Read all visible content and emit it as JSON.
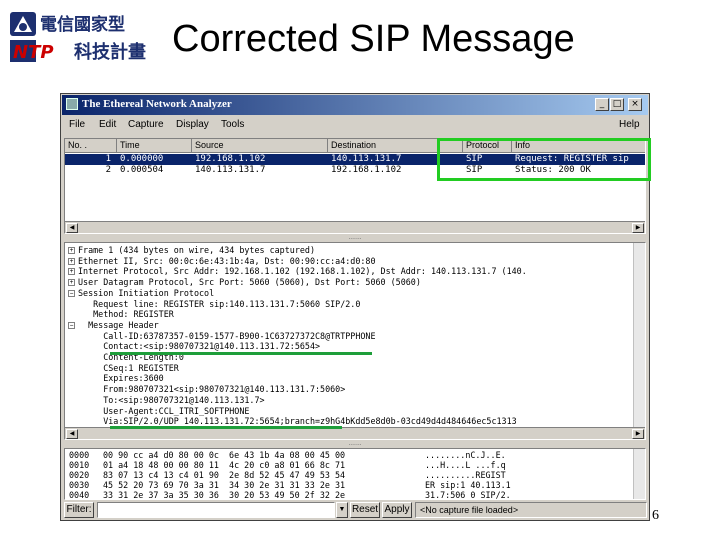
{
  "slide": {
    "title": "Corrected SIP Message",
    "page_number": "6",
    "logo_text_en": "NTP",
    "logo_text_zh_top": "電信國家型",
    "logo_text_zh_bottom": "科技計畫"
  },
  "window": {
    "title": "The Ethereal Network Analyzer",
    "buttons": {
      "minimize": "_",
      "maximize": "□",
      "close": "×"
    }
  },
  "menu": {
    "file": "File",
    "edit": "Edit",
    "capture": "Capture",
    "display": "Display",
    "tools": "Tools",
    "help": "Help"
  },
  "packet_list": {
    "columns": [
      "No. .",
      "Time",
      "Source",
      "Destination",
      "Protocol",
      "Info"
    ],
    "rows": [
      {
        "no": "1",
        "time": "0.000000",
        "source": "192.168.1.102",
        "destination": "140.113.131.7",
        "protocol": "SIP",
        "info": "Request: REGISTER sip",
        "selected": true
      },
      {
        "no": "2",
        "time": "0.000504",
        "source": "140.113.131.7",
        "destination": "192.168.1.102",
        "protocol": "SIP",
        "info": "Status: 200 OK",
        "selected": false
      }
    ]
  },
  "detail_tree": {
    "lines": [
      {
        "toggle": "⊞",
        "text": "Frame 1 (434 bytes on wire, 434 bytes captured)"
      },
      {
        "toggle": "⊞",
        "text": "Ethernet II, Src: 00:0c:6e:43:1b:4a, Dst: 00:90:cc:a4:d0:80"
      },
      {
        "toggle": "⊞",
        "text": "Internet Protocol, Src Addr: 192.168.1.102 (192.168.1.102), Dst Addr: 140.113.131.7 (140."
      },
      {
        "toggle": "⊞",
        "text": "User Datagram Protocol, Src Port: 5060 (5060), Dst Port: 5060 (5060)"
      },
      {
        "toggle": "⊟",
        "text": "Session Initiation Protocol"
      },
      {
        "toggle": "",
        "text": "   Request line: REGISTER sip:140.113.131.7:5060 SIP/2.0"
      },
      {
        "toggle": "",
        "text": "   Method: REGISTER"
      },
      {
        "toggle": "⊟",
        "text": "  Message Header"
      },
      {
        "toggle": "",
        "text": "     Call-ID:63787357-0159-1577-B900-1C63727372C8@TRTPPHONE"
      },
      {
        "toggle": "",
        "text": "     Contact:<sip:980707321@140.113.131.72:5654>"
      },
      {
        "toggle": "",
        "text": "     Content-Length:0"
      },
      {
        "toggle": "",
        "text": "     CSeq:1 REGISTER"
      },
      {
        "toggle": "",
        "text": "     Expires:3600"
      },
      {
        "toggle": "",
        "text": "     From:980707321<sip:980707321@140.113.131.7:5060>"
      },
      {
        "toggle": "",
        "text": "     To:<sip:980707321@140.113.131.7>"
      },
      {
        "toggle": "",
        "text": "     User-Agent:CCL_ITRI_SOFTPHONE"
      },
      {
        "toggle": "",
        "text": "     Via:SIP/2.0/UDP 140.113.131.72:5654;branch=z9hG4bKdd5e8d0b-03cd49d4d484646ec5c1313"
      }
    ]
  },
  "hex_dump": {
    "rows": [
      {
        "offset": "0000",
        "hex": "00 90 cc a4 d0 80 00 0c  6e 43 1b 4a 08 00 45 00",
        "ascii": "........nC.J..E."
      },
      {
        "offset": "0010",
        "hex": "01 a4 18 48 00 00 80 11  4c 20 c0 a8 01 66 8c 71",
        "ascii": "...H....L ...f.q"
      },
      {
        "offset": "0020",
        "hex": "83 07 13 c4 13 c4 01 90  2e 8d 52 45 47 49 53 54",
        "ascii": "..........REGIST"
      },
      {
        "offset": "0030",
        "hex": "45 52 20 73 69 70 3a 31  34 30 2e 31 31 33 2e 31",
        "ascii": "ER sip:1 40.113.1"
      },
      {
        "offset": "0040",
        "hex": "33 31 2e 37 3a 35 30 36  30 20 53 49 50 2f 32 2e",
        "ascii": "31.7:506 0 SIP/2."
      }
    ]
  },
  "filter_bar": {
    "filter_label": "Filter:",
    "filter_value": "",
    "reset_label": "Reset",
    "apply_label": "Apply",
    "status_text": "<No capture file loaded>"
  },
  "colors": {
    "highlight_box": "#22cc22",
    "underline": "#1e9e3a",
    "selection": "#0a246a"
  }
}
